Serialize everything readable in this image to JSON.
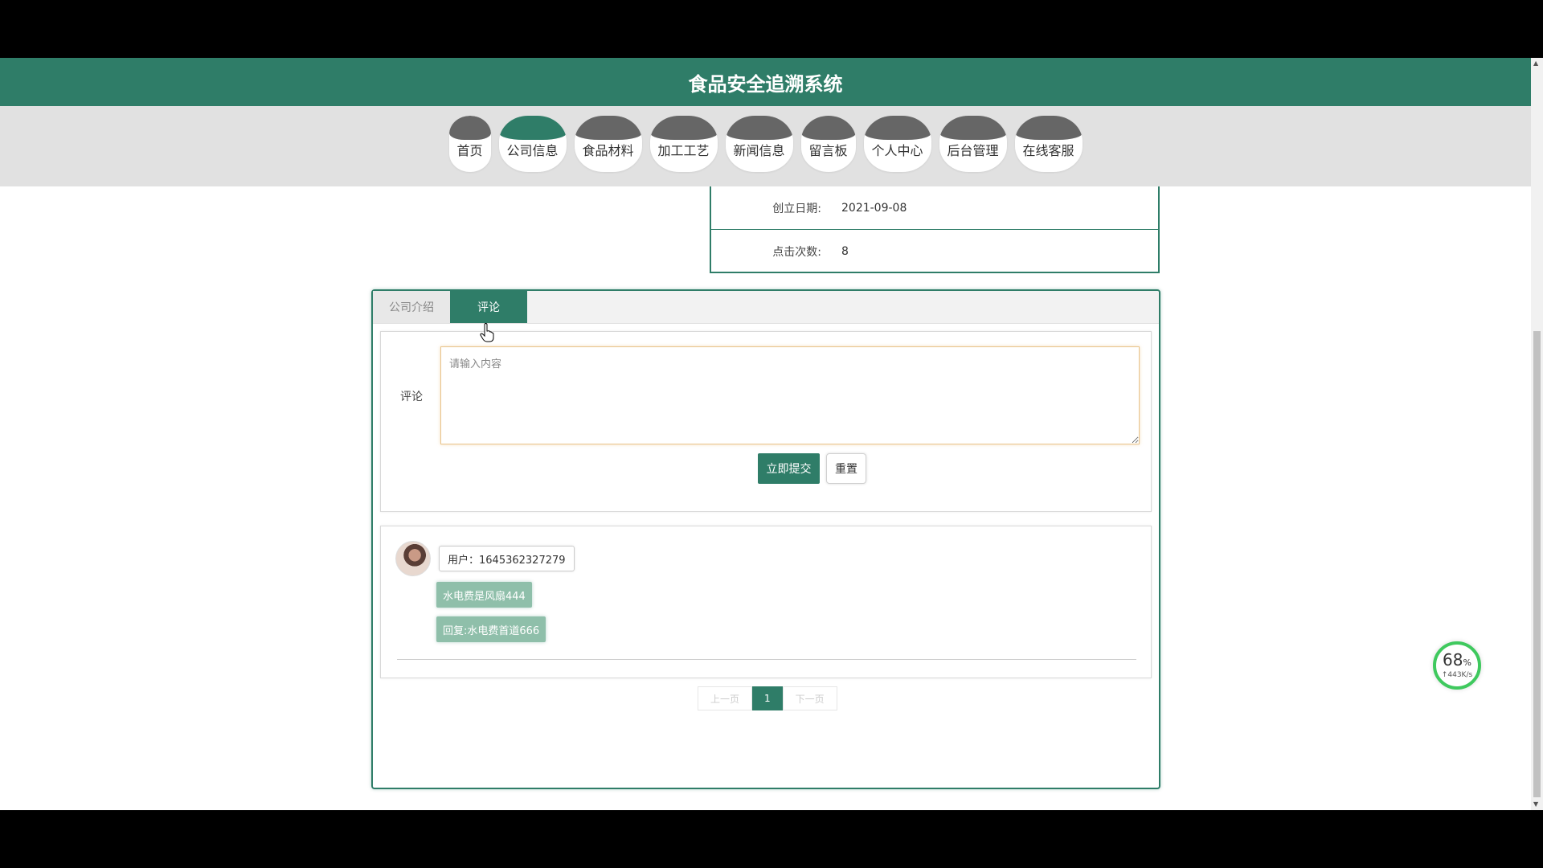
{
  "header": {
    "title": "食品安全追溯系统"
  },
  "nav": {
    "items": [
      {
        "label": "首页",
        "active": false
      },
      {
        "label": "公司信息",
        "active": true
      },
      {
        "label": "食品材料",
        "active": false
      },
      {
        "label": "加工工艺",
        "active": false
      },
      {
        "label": "新闻信息",
        "active": false
      },
      {
        "label": "留言板",
        "active": false
      },
      {
        "label": "个人中心",
        "active": false
      },
      {
        "label": "后台管理",
        "active": false
      },
      {
        "label": "在线客服",
        "active": false
      }
    ]
  },
  "info": {
    "founded_label": "创立日期:",
    "founded_value": "2021-09-08",
    "clicks_label": "点击次数:",
    "clicks_value": "8"
  },
  "tabs": [
    {
      "label": "公司介绍",
      "active": false
    },
    {
      "label": "评论",
      "active": true
    }
  ],
  "comment_form": {
    "label": "评论",
    "placeholder": "请输入内容",
    "submit_label": "立即提交",
    "reset_label": "重置"
  },
  "comments": [
    {
      "user": "用户：1645362327279",
      "content": "水电费是风扇444",
      "reply": "回复:水电费首道666"
    }
  ],
  "pagination": {
    "prev": "上一页",
    "current": "1",
    "next": "下一页"
  },
  "speed_widget": {
    "percent": "68",
    "percent_unit": "%",
    "rate": "↑443K/s"
  },
  "colors": {
    "primary": "#2f7d68",
    "nav_inactive": "#666666",
    "accent_border": "#e9c48b"
  }
}
